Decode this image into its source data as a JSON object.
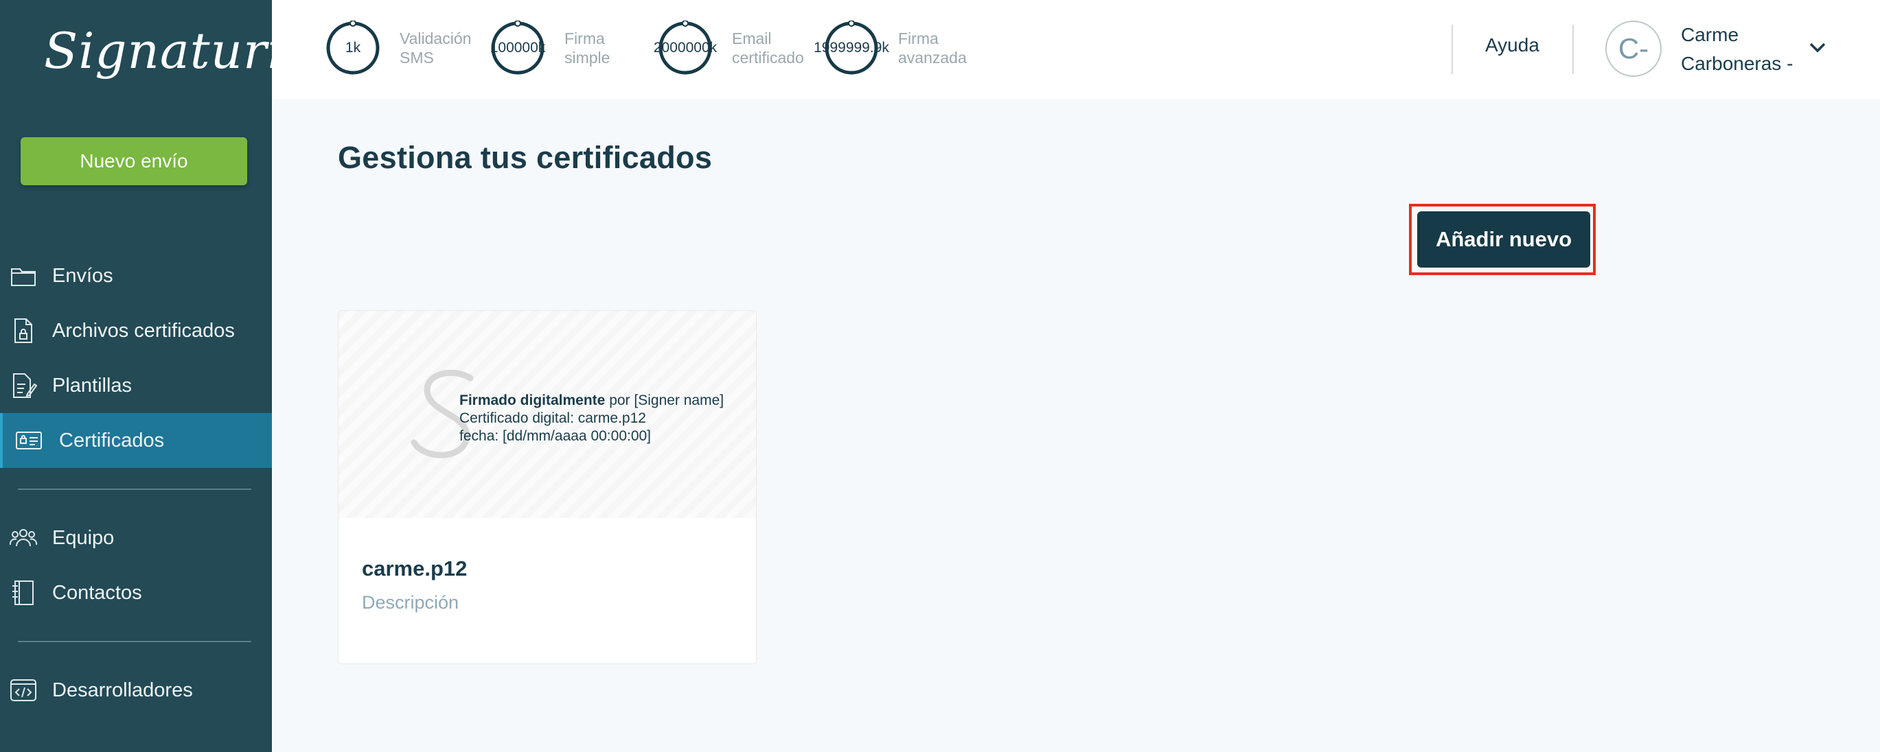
{
  "brand": {
    "logo_text": "Signaturit"
  },
  "sidebar": {
    "new_button": "Nuevo envío",
    "items": [
      {
        "label": "Envíos",
        "icon": "folder-icon"
      },
      {
        "label": "Archivos certificados",
        "icon": "certified-file-icon"
      },
      {
        "label": "Plantillas",
        "icon": "template-icon"
      },
      {
        "label": "Certificados",
        "icon": "id-card-icon",
        "active": true
      },
      {
        "label": "Equipo",
        "icon": "team-icon"
      },
      {
        "label": "Contactos",
        "icon": "contacts-book-icon"
      },
      {
        "label": "Desarrolladores",
        "icon": "code-icon"
      }
    ]
  },
  "topbar": {
    "counters": [
      {
        "value": "1k",
        "caption_line1": "Validación",
        "caption_line2": "SMS"
      },
      {
        "value": "100000k",
        "caption_line1": "Firma",
        "caption_line2": "simple"
      },
      {
        "value": "2000000k",
        "caption_line1": "Email",
        "caption_line2": "certificado"
      },
      {
        "value": "1999999.9k",
        "caption_line1": "Firma",
        "caption_line2": "avanzada"
      }
    ],
    "help": "Ayuda",
    "user": {
      "initials": "C-",
      "first_line": "Carme",
      "second_line": "Carboneras -"
    }
  },
  "main": {
    "title": "Gestiona tus certificados",
    "add_button": "Añadir nuevo",
    "certificates": [
      {
        "name": "carme.p12",
        "description": "Descripción",
        "preview": {
          "bold": "Firmado digitalmente",
          "rest": " por [Signer name]",
          "line2": "Certificado digital: carme.p12",
          "line3": "fecha: [dd/mm/aaaa 00:00:00]"
        }
      }
    ]
  },
  "colors": {
    "sidebar": "#234a55",
    "active_item": "#1e7797",
    "new_button": "#7ab842",
    "primary_button": "#163a47",
    "highlight_frame": "#e2311d"
  }
}
